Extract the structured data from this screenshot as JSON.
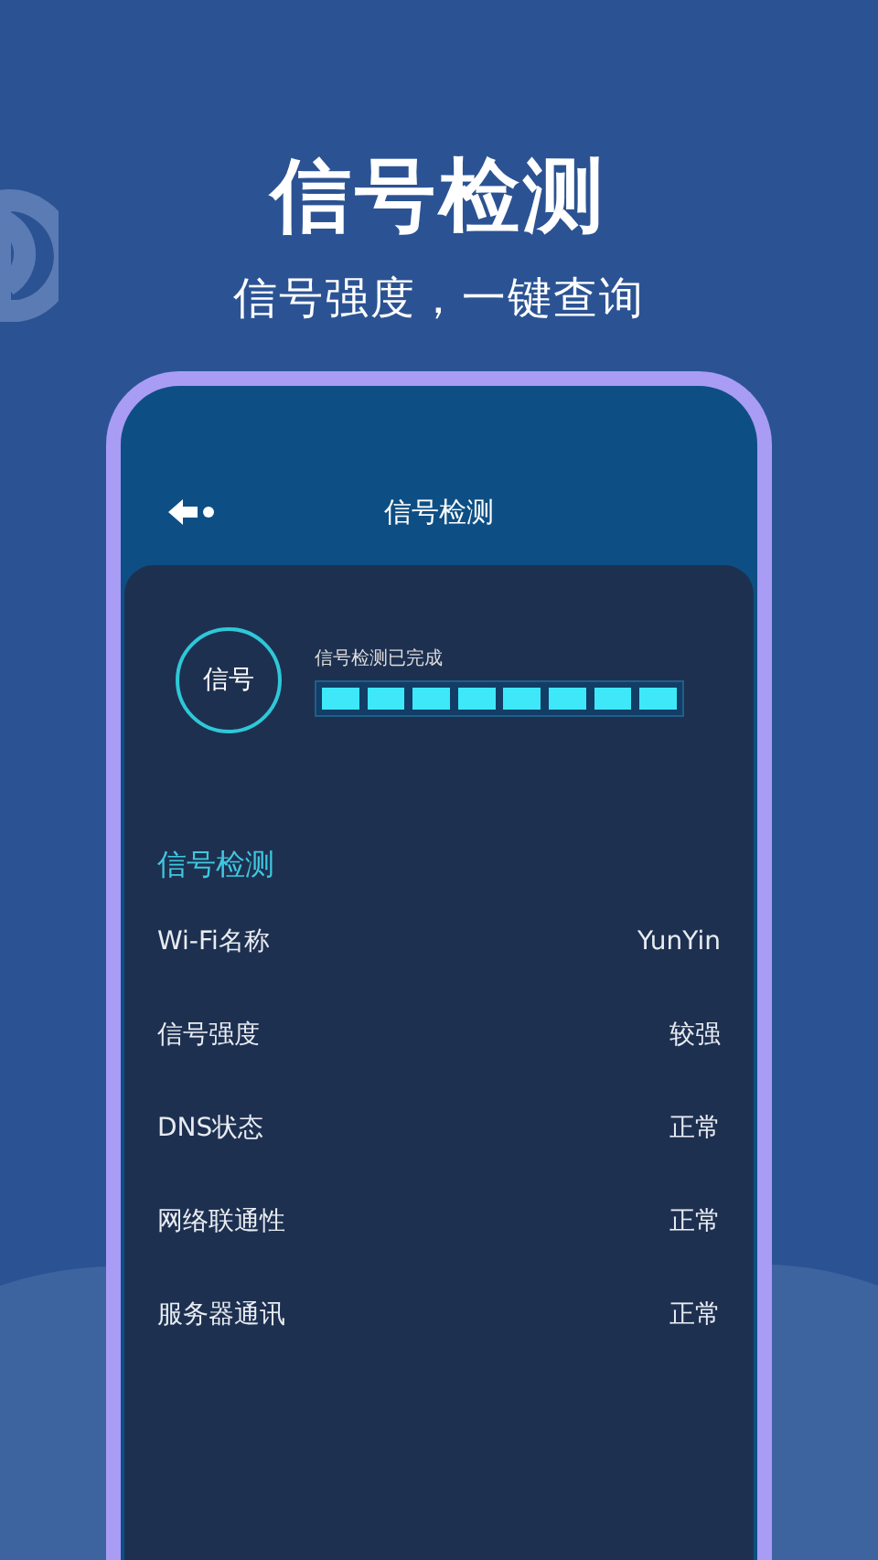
{
  "headline": "信号检测",
  "subtitle": "信号强度，一键查询",
  "phone": {
    "title": "信号检测",
    "badge": "信号",
    "progress": {
      "label": "信号检测已完成",
      "level": 1
    },
    "section_title": "信号检测",
    "rows": [
      {
        "label": "Wi-Fi名称",
        "value": "YunYin"
      },
      {
        "label": "信号强度",
        "value": "较强"
      },
      {
        "label": "DNS状态",
        "value": "正常"
      },
      {
        "label": "网络联通性",
        "value": "正常"
      },
      {
        "label": "服务器通讯",
        "value": "正常"
      }
    ]
  }
}
